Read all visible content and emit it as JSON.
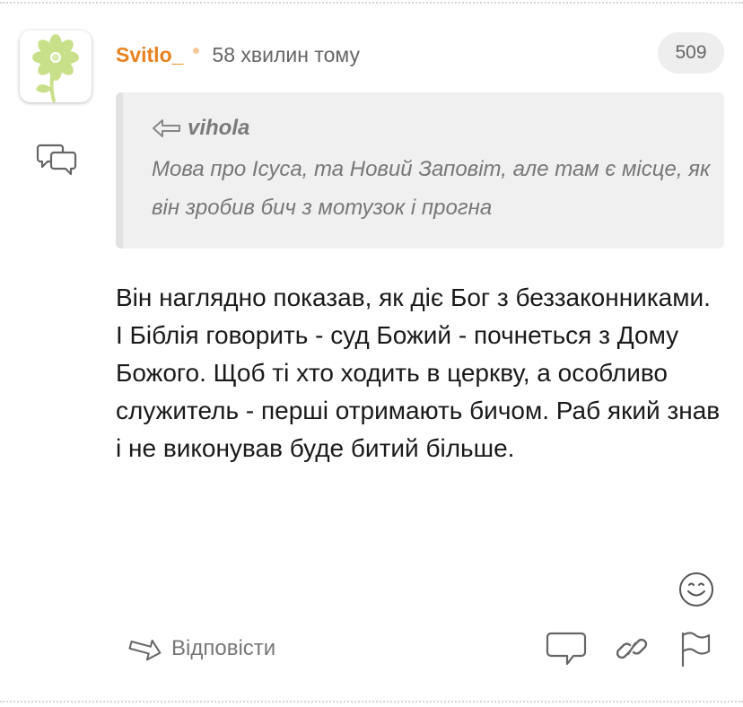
{
  "comment": {
    "author": "Svitlo_",
    "time": "58 хвилин тому",
    "count": "509",
    "avatar_icon": "flower-icon",
    "quote": {
      "author": "vihola",
      "text": "Мова про Ісуса, та Новий Заповіт, але там є місце, як він зробив бич з мотузок і прогна"
    },
    "text": "Він наглядно показав, як діє Бог з беззаконниками.\nІ Біблія говорить - суд Божий - почнеться з Дому Божого. Щоб ті хто ходить в церкву, а особливо служитель - перші отримають бичом. Раб який знав і не виконував буде битий більше."
  },
  "actions": {
    "reply_label": "Відповісти",
    "icons": [
      "reply-arrow-icon",
      "comments-icon",
      "link-icon",
      "flag-icon",
      "smiley-icon"
    ]
  },
  "colors": {
    "author": "#e8821e",
    "dot": "#f4c99a",
    "flower": "#c9e08a",
    "quote_bg": "#f0f0f0",
    "icon": "#666666"
  }
}
